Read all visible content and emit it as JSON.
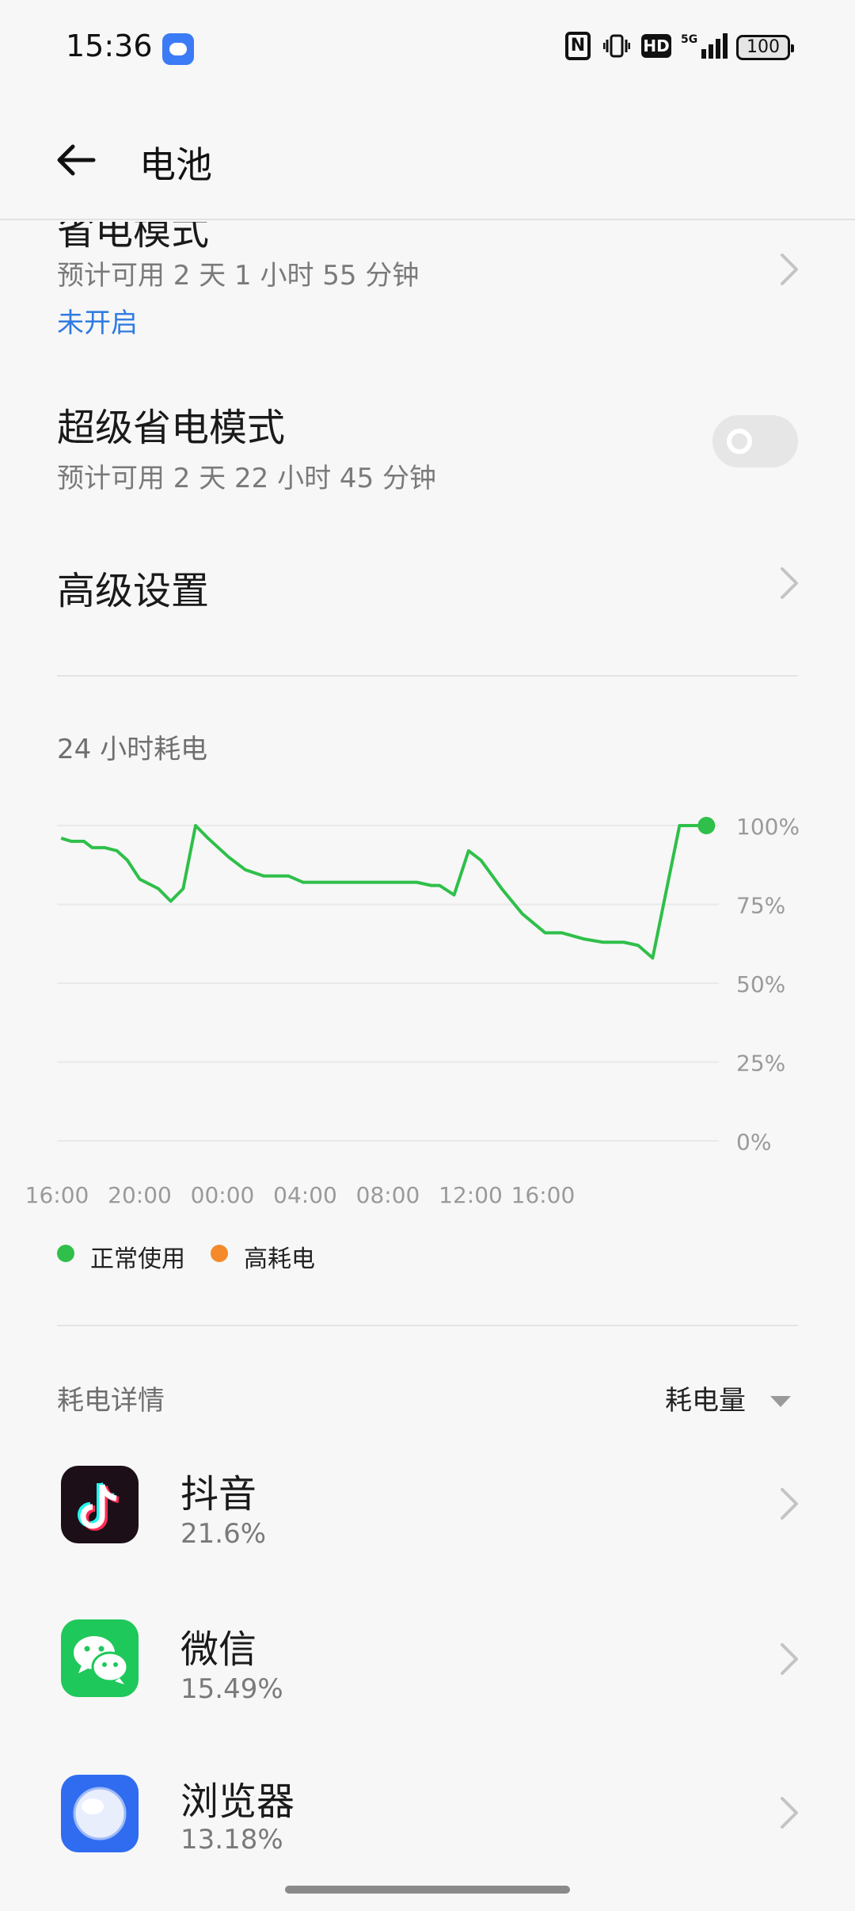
{
  "status_bar": {
    "time": "15:36",
    "battery": "100",
    "icons": [
      "cloud-app-icon",
      "nfc-icon",
      "vibrate-icon",
      "hd-icon",
      "5g-signal-icon",
      "battery-icon"
    ],
    "hd_label": "HD",
    "nfc_label": "N",
    "signal_label": "⁵ᴳıl"
  },
  "header": {
    "title": "电池",
    "back_icon": "arrow-left-icon"
  },
  "power_saving": {
    "title": "省电模式",
    "estimate": "预计可用 2 天 1 小时 55 分钟",
    "state": "未开启",
    "state_color": "#2f7be0"
  },
  "super_saving": {
    "title": "超级省电模式",
    "estimate": "预计可用 2 天 22 小时 45 分钟",
    "enabled": false
  },
  "advanced": {
    "title": "高级设置"
  },
  "usage_chart_section": {
    "title": "24 小时耗电"
  },
  "chart_data": {
    "type": "line",
    "title": "24 小时耗电",
    "x_ticks": [
      "16:00",
      "20:00",
      "00:00",
      "04:00",
      "08:00",
      "12:00",
      "16:00"
    ],
    "y_ticks": [
      "100%",
      "75%",
      "50%",
      "25%",
      "0%"
    ],
    "ylim": [
      0,
      100
    ],
    "x_range_hours": [
      -23.6,
      0
    ],
    "legend": [
      {
        "label": "正常使用",
        "color": "#2fbf4a"
      },
      {
        "label": "高耗电",
        "color": "#f58a2a"
      }
    ],
    "series": [
      {
        "color": "#2fbf4a",
        "points": [
          [
            -23.6,
            96
          ],
          [
            -23.1,
            95
          ],
          [
            -22.5,
            95
          ],
          [
            -22.1,
            93
          ],
          [
            -21.5,
            93
          ],
          [
            -20.9,
            92
          ],
          [
            -20.4,
            89
          ],
          [
            -19.8,
            83
          ],
          [
            -18.9,
            80
          ],
          [
            -18.3,
            76
          ],
          [
            -17.7,
            80
          ],
          [
            -17.1,
            100
          ],
          [
            -16.5,
            96
          ],
          [
            -15.5,
            90
          ],
          [
            -14.7,
            86
          ],
          [
            -13.8,
            84
          ],
          [
            -12.6,
            84
          ],
          [
            -11.9,
            82
          ],
          [
            -8.4,
            82
          ],
          [
            -6.4,
            82
          ],
          [
            -5.7,
            81
          ],
          [
            -5.3,
            81
          ],
          [
            -4.6,
            78
          ],
          [
            -3.9,
            92
          ],
          [
            -3.3,
            89
          ],
          [
            -2.3,
            80
          ],
          [
            -1.3,
            72
          ],
          [
            -0.2,
            66
          ],
          [
            0.6,
            66
          ],
          [
            1.7,
            64
          ],
          [
            2.6,
            63
          ],
          [
            3.6,
            63
          ],
          [
            4.3,
            62
          ],
          [
            5.0,
            58
          ],
          [
            6.3,
            100
          ],
          [
            7.6,
            100
          ]
        ]
      }
    ]
  },
  "details": {
    "title": "耗电详情",
    "sort_label": "耗电量"
  },
  "apps": [
    {
      "name": "抖音",
      "percent": "21.6%",
      "icon": "douyin-icon"
    },
    {
      "name": "微信",
      "percent": "15.49%",
      "icon": "wechat-icon"
    },
    {
      "name": "浏览器",
      "percent": "13.18%",
      "icon": "browser-icon"
    }
  ]
}
